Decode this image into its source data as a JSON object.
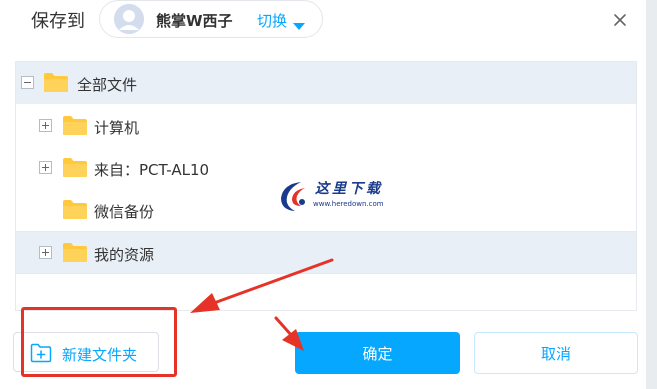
{
  "header": {
    "title": "保存到",
    "account_name": "熊掌W西子",
    "switch_label": "切换"
  },
  "tree": {
    "root": {
      "label": "全部文件",
      "expanded": true,
      "selected": true
    },
    "items": [
      {
        "label": "计算机",
        "has_toggle": true
      },
      {
        "label": "来自：PCT-AL10",
        "has_toggle": true
      },
      {
        "label": "微信备份",
        "has_toggle": false
      },
      {
        "label": "我的资源",
        "has_toggle": true
      }
    ]
  },
  "watermark": {
    "text": "这里下载",
    "url": "www.heredown.com"
  },
  "footer": {
    "new_folder_label": "新建文件夹",
    "confirm_label": "确定",
    "cancel_label": "取消"
  },
  "colors": {
    "accent": "#06a7ff",
    "folder": "#ffc83d",
    "selected_row": "#e9eff7",
    "annotation": "#e53327"
  },
  "icons": {
    "avatar": "user-avatar-icon",
    "caret": "caret-down-icon",
    "close": "close-icon",
    "folder": "folder-icon",
    "expand": "plus-box-icon",
    "collapse": "minus-box-icon",
    "new_folder": "folder-plus-icon"
  }
}
